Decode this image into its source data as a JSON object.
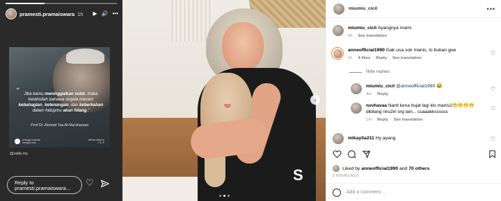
{
  "story": {
    "username": "pramesti.pramaiswara",
    "time": "1h",
    "controls": [
      "▶",
      "🔊",
      "•••"
    ],
    "quote_mark": "“",
    "quote_parts": [
      {
        "t": "Jika kamu ",
        "b": false
      },
      {
        "t": "meninggalkan solat",
        "b": true
      },
      {
        "t": ", maka ketahuilah bahawa segala macam ",
        "b": false
      },
      {
        "t": "kebahagian",
        "b": true
      },
      {
        "t": ", ",
        "b": false
      },
      {
        "t": "ketenangan",
        "b": true
      },
      {
        "t": ", dan ",
        "b": false
      },
      {
        "t": "keberkahan",
        "b": true
      },
      {
        "t": " dalam hidupmu ",
        "b": false
      },
      {
        "t": "akan hilang",
        "b": true
      },
      {
        "t": ".”",
        "b": false
      }
    ],
    "author": "Prof Dr. Ahmad 'Isa Al-Ma'sharawi",
    "logo_text_1": "sebagai motivasi",
    "logo_text_2": "menjadi baik",
    "social_text": "official.zafly.my",
    "social_icons": "f  ◎  ✈",
    "credit": "@zalfa.my",
    "reply_placeholder": "Reply to pramesti.pramaiswara...",
    "progress": 0.35
  },
  "photo": {
    "next_arrow": "›",
    "dots": 3,
    "active_dot": 1,
    "shirt_letter": "S"
  },
  "panel": {
    "header_user": "miumiu_cicil",
    "more": "•••",
    "hide_replies": "Hide replies",
    "comments": [
      {
        "user": "miumiu_cicil",
        "text": "Ayangnya mami",
        "time": "2h",
        "likes": "",
        "reply": "",
        "translation": "See translation"
      },
      {
        "user": "anneofficial1990",
        "text": "Gak usa sok manis, lo bukan gue",
        "time": "1h",
        "likes": "4 likes",
        "reply": "Reply",
        "translation": "See translation"
      },
      {
        "user": "miumiu_cicil",
        "mention": "@anneofficial1990",
        "text": " 😂",
        "time": "4m",
        "reply": "Reply"
      },
      {
        "user": "novhavaa",
        "text": "Nanti kena hujat lagi klo manis2😁😁😁😁 dibilang niru2in org lain... cuaaakkssssss",
        "time": "1m",
        "reply": "Reply",
        "translation": "See translation"
      },
      {
        "user": "mikaylla211",
        "text": "Hy ayang",
        "time": ""
      }
    ],
    "liked_by_prefix": "Liked by ",
    "liked_by_user": "anneofficial1990",
    "liked_by_and": " and ",
    "liked_by_others": "70 others",
    "date": "2 HOURS AGO",
    "add_comment": "Add a comment…"
  },
  "colors": {
    "story_bg": "#2a2a2a",
    "mention": "#00376b",
    "muted": "#8e8e8e",
    "story_ring": "#f58529"
  }
}
